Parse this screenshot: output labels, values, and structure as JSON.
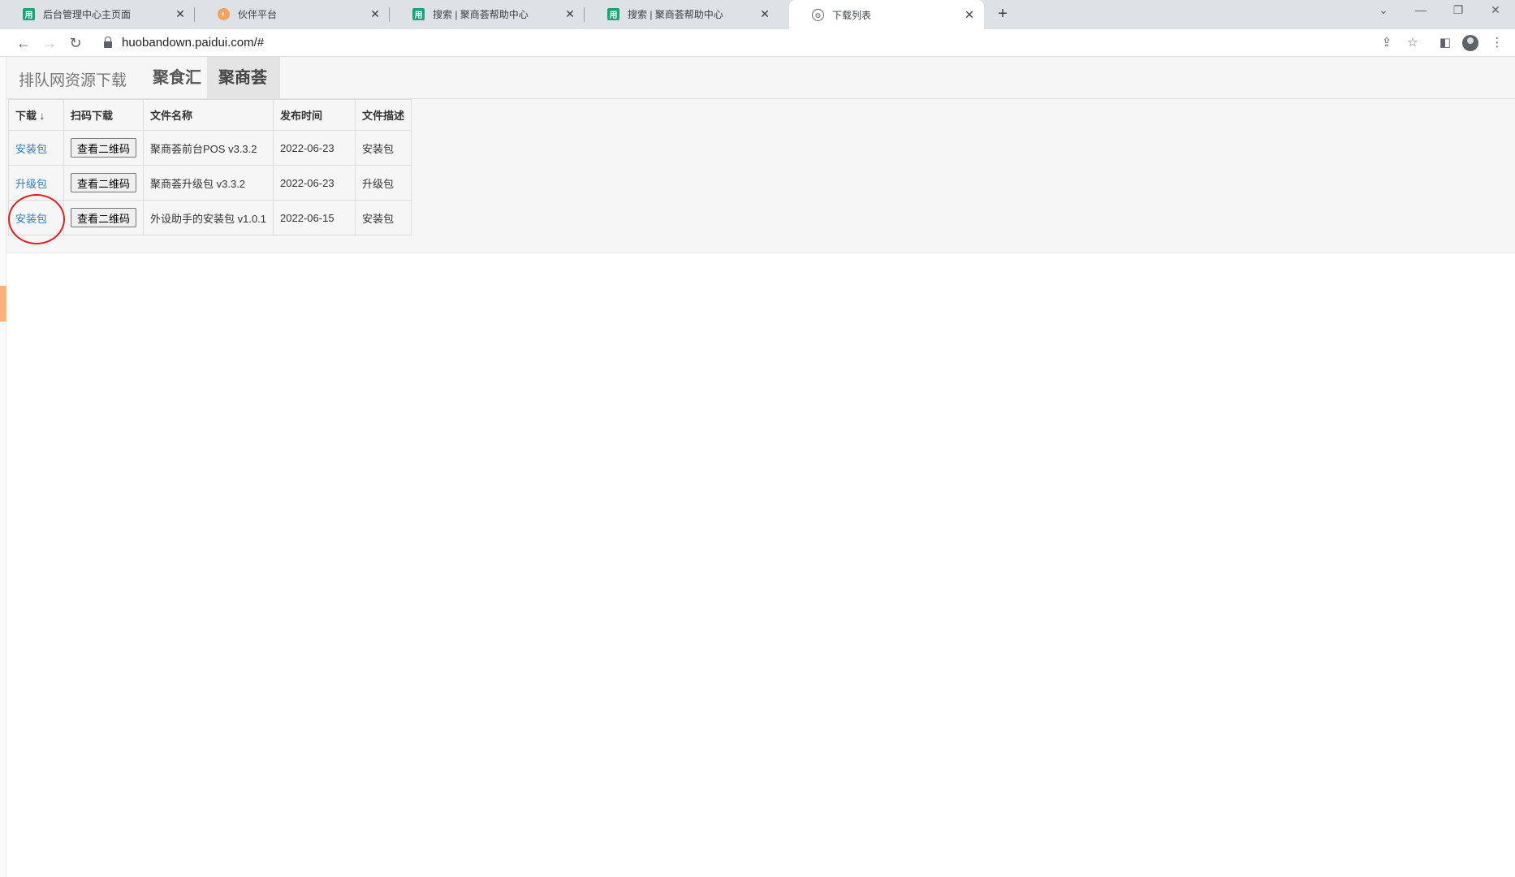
{
  "browser": {
    "tabs": [
      {
        "title": "后台管理中心主页面",
        "icon": "app-icon",
        "active": false
      },
      {
        "title": "伙伴平台",
        "icon": "partner-icon",
        "active": false
      },
      {
        "title": "搜索 | 聚商荟帮助中心",
        "icon": "app-icon",
        "active": false
      },
      {
        "title": "搜索 | 聚商荟帮助中心",
        "icon": "app-icon",
        "active": false
      },
      {
        "title": "下载列表",
        "icon": "globe-icon",
        "active": true
      }
    ],
    "url": "huobandown.paidui.com/#"
  },
  "page": {
    "brand": "排队网资源下载",
    "nav": [
      {
        "label": "聚食汇",
        "active": false
      },
      {
        "label": "聚商荟",
        "active": true
      }
    ],
    "table": {
      "headers": [
        "下载 ↓",
        "扫码下载",
        "文件名称",
        "发布时间",
        "文件描述"
      ],
      "rows": [
        {
          "download": "安装包",
          "qr": "查看二维码",
          "name": "聚商荟前台POS v3.3.2",
          "date": "2022-06-23",
          "desc": "安装包"
        },
        {
          "download": "升级包",
          "qr": "查看二维码",
          "name": "聚商荟升级包 v3.3.2",
          "date": "2022-06-23",
          "desc": "升级包"
        },
        {
          "download": "安装包",
          "qr": "查看二维码",
          "name": "外设助手的安装包 v1.0.1",
          "date": "2022-06-15",
          "desc": "安装包"
        }
      ]
    }
  },
  "annotation": {
    "color": "#e02020"
  }
}
